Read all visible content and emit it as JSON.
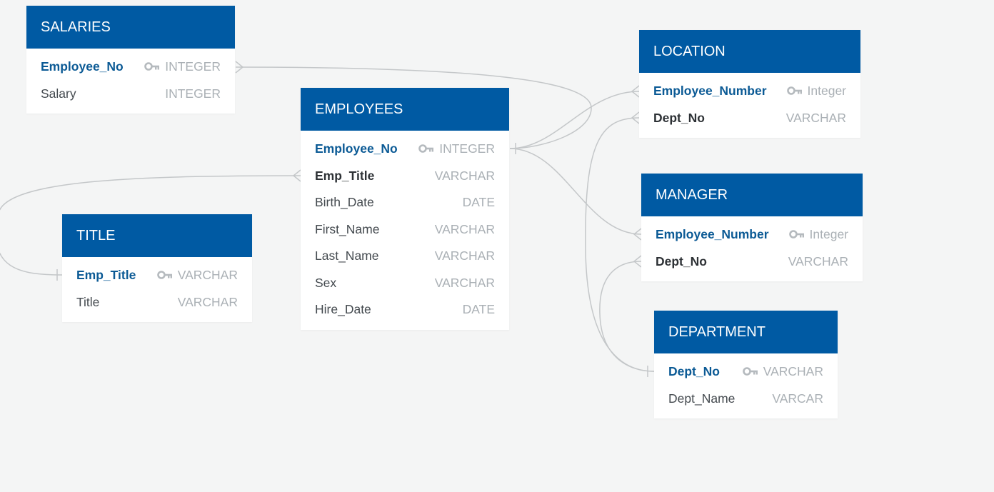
{
  "colors": {
    "header": "#005aa3",
    "primary_key_text": "#0b5a95",
    "foreign_key_text": "#2d3135",
    "field_text": "#444a4f",
    "type_text": "#aab0b5",
    "connector": "#c4c7c9",
    "background": "#f4f5f5"
  },
  "entities": {
    "salaries": {
      "name": "SALARIES",
      "fields": [
        {
          "name": "Employee_No",
          "type": "INTEGER",
          "key": "pk"
        },
        {
          "name": "Salary",
          "type": "INTEGER",
          "key": ""
        }
      ]
    },
    "employees": {
      "name": "EMPLOYEES",
      "fields": [
        {
          "name": "Employee_No",
          "type": "INTEGER",
          "key": "pk"
        },
        {
          "name": "Emp_Title",
          "type": "VARCHAR",
          "key": "fk"
        },
        {
          "name": "Birth_Date",
          "type": "DATE",
          "key": ""
        },
        {
          "name": "First_Name",
          "type": "VARCHAR",
          "key": ""
        },
        {
          "name": "Last_Name",
          "type": "VARCHAR",
          "key": ""
        },
        {
          "name": "Sex",
          "type": "VARCHAR",
          "key": ""
        },
        {
          "name": "Hire_Date",
          "type": "DATE",
          "key": ""
        }
      ]
    },
    "title": {
      "name": "TITLE",
      "fields": [
        {
          "name": "Emp_Title",
          "type": "VARCHAR",
          "key": "pk"
        },
        {
          "name": "Title",
          "type": "VARCHAR",
          "key": ""
        }
      ]
    },
    "location": {
      "name": "LOCATION",
      "fields": [
        {
          "name": "Employee_Number",
          "type": "Integer",
          "key": "pk"
        },
        {
          "name": "Dept_No",
          "type": "VARCHAR",
          "key": "fk"
        }
      ]
    },
    "manager": {
      "name": "MANAGER",
      "fields": [
        {
          "name": "Employee_Number",
          "type": "Integer",
          "key": "pk"
        },
        {
          "name": "Dept_No",
          "type": "VARCHAR",
          "key": "fk"
        }
      ]
    },
    "department": {
      "name": "DEPARTMENT",
      "fields": [
        {
          "name": "Dept_No",
          "type": "VARCHAR",
          "key": "pk"
        },
        {
          "name": "Dept_Name",
          "type": "VARCAR",
          "key": ""
        }
      ]
    }
  },
  "relationships": [
    {
      "from": "employees.Employee_No",
      "to": "salaries.Employee_No",
      "from_end": "one",
      "to_end": "many"
    },
    {
      "from": "employees.Employee_No",
      "to": "location.Employee_Number",
      "from_end": "one",
      "to_end": "many"
    },
    {
      "from": "employees.Employee_No",
      "to": "manager.Employee_Number",
      "from_end": "one",
      "to_end": "many"
    },
    {
      "from": "title.Emp_Title",
      "to": "employees.Emp_Title",
      "from_end": "one",
      "to_end": "many"
    },
    {
      "from": "department.Dept_No",
      "to": "location.Dept_No",
      "from_end": "one",
      "to_end": "many"
    },
    {
      "from": "department.Dept_No",
      "to": "manager.Dept_No",
      "from_end": "one",
      "to_end": "many"
    }
  ]
}
